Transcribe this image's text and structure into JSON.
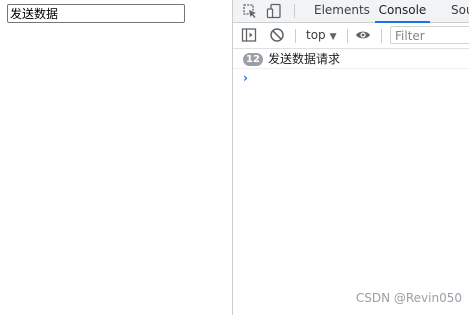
{
  "page": {
    "input_value": "发送数据"
  },
  "devtools": {
    "icons": [
      "inspect-element-icon",
      "device-toolbar-icon"
    ],
    "tabs": [
      {
        "label": "Elements",
        "active": false
      },
      {
        "label": "Console",
        "active": true
      },
      {
        "label": "Sou",
        "active": false
      }
    ],
    "toolbar": {
      "sidebar_icon": "sidebar-toggle-icon",
      "clear_icon": "clear-console-icon",
      "context_label": "top",
      "context_arrow": "▼",
      "eye_icon": "live-expression-icon",
      "filter_placeholder": "Filter"
    },
    "console": {
      "messages": [
        {
          "count": "12",
          "text": "发送数据请求"
        }
      ],
      "prompt": "›"
    },
    "colors": {
      "accent": "#1a73e8",
      "badge": "#9aa0a6",
      "tabbar_bg": "#f1f3f4"
    }
  },
  "watermark": "CSDN @Revin050"
}
